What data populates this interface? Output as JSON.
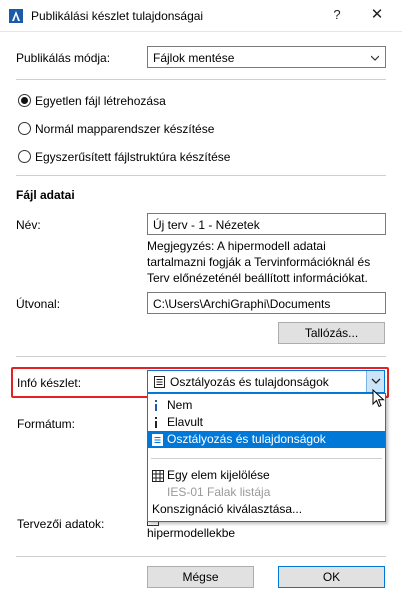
{
  "window": {
    "title": "Publikálási készlet tulajdonságai",
    "help": "?",
    "close": "✕"
  },
  "publish_mode": {
    "label": "Publikálás módja:",
    "value": "Fájlok mentése"
  },
  "radios": [
    {
      "label": "Egyetlen fájl létrehozása",
      "checked": true
    },
    {
      "label": "Normál mapparendszer készítése",
      "checked": false
    },
    {
      "label": "Egyszerűsített fájlstruktúra készítése",
      "checked": false
    }
  ],
  "file_data": {
    "heading": "Fájl adatai",
    "name_label": "Név:",
    "name_value": "Új terv - 1 - Nézetek",
    "note": "Megjegyzés: A hipermodell adatai tartalmazni fogják a Tervinformációknál és Terv előnézeténél beállított információkat.",
    "path_label": "Útvonal:",
    "path_value": "C:\\Users\\ArchiGraphi\\Documents",
    "browse_button": "Tallózás..."
  },
  "info_set": {
    "label": "Infó készlet:",
    "value": "Osztályozás és tulajdonságok"
  },
  "format_label": "Formátum:",
  "designer_data_label": "Tervezői adatok:",
  "hidden_fragment": "hipermodellekbe",
  "dropdown_items": [
    {
      "label": "Nem",
      "icon": "info-icon",
      "state": "normal"
    },
    {
      "label": "Elavult",
      "icon": "info-icon",
      "state": "normal"
    },
    {
      "label": "Osztályozás és tulajdonságok",
      "icon": "document-list-icon",
      "state": "selected"
    },
    {
      "label": "Egy elem kijelölése",
      "icon": "grid-icon",
      "state": "normal"
    },
    {
      "label": "IES-01 Falak listája",
      "icon": "",
      "state": "disabled"
    },
    {
      "label": "Konszignáció kiválasztása...",
      "icon": "",
      "state": "normal"
    }
  ],
  "buttons": {
    "cancel": "Mégse",
    "ok": "OK"
  },
  "colors": {
    "accent": "#0078d7",
    "highlight": "#e32222",
    "selected_bg": "#0078d7"
  }
}
